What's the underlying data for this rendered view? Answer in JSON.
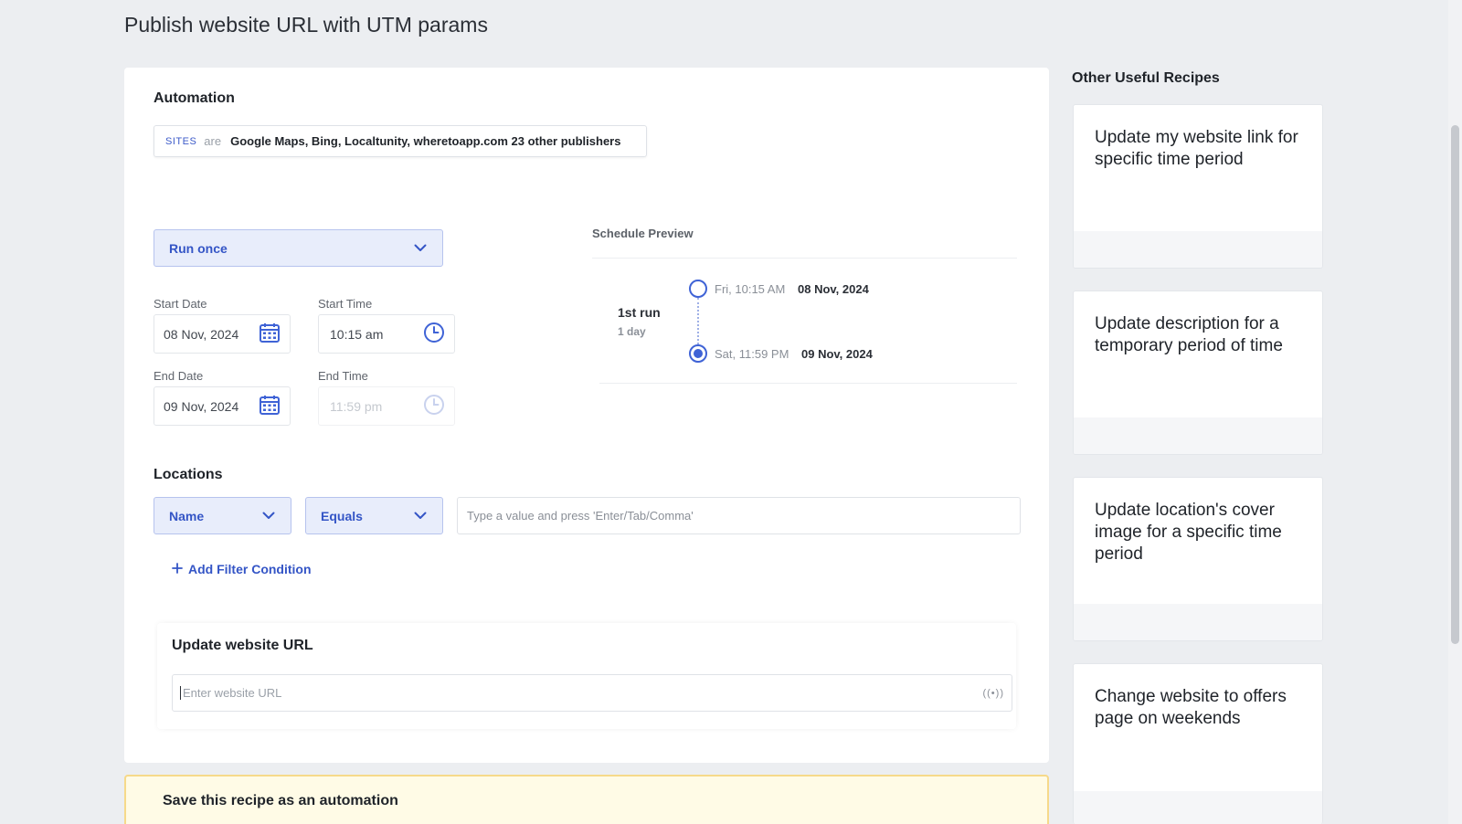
{
  "page": {
    "title": "Publish website URL with UTM params"
  },
  "automation": {
    "heading": "Automation",
    "sites": {
      "key": "SITES",
      "operator": "are",
      "value": "Google Maps, Bing, Localtunity, wheretoapp.com 23 other publishers"
    }
  },
  "schedule": {
    "frequency": "Run once",
    "start_date_label": "Start Date",
    "start_date": "08 Nov, 2024",
    "start_time_label": "Start Time",
    "start_time": "10:15 am",
    "end_date_label": "End Date",
    "end_date": "09 Nov, 2024",
    "end_time_label": "End Time",
    "end_time": "11:59 pm",
    "preview": {
      "title": "Schedule Preview",
      "run_label": "1st run",
      "run_duration": "1 day",
      "start": {
        "time": "Fri, 10:15 AM",
        "date": "08 Nov, 2024"
      },
      "end": {
        "time": "Sat, 11:59 PM",
        "date": "09 Nov, 2024"
      }
    }
  },
  "locations": {
    "heading": "Locations",
    "field": "Name",
    "operator": "Equals",
    "value_placeholder": "Type a value and press 'Enter/Tab/Comma'",
    "add_filter": "Add Filter Condition"
  },
  "action": {
    "heading": "Update website URL",
    "url_placeholder": "Enter website URL",
    "variable_icon_text": "((•))"
  },
  "save": {
    "title": "Save this recipe as an automation"
  },
  "sidebar": {
    "heading": "Other Useful Recipes",
    "recipes": [
      {
        "title": "Update my website link for specific time period"
      },
      {
        "title": "Update description for a temporary period of time"
      },
      {
        "title": "Update location's cover image for a specific time period"
      },
      {
        "title": "Change website to offers page on weekends"
      }
    ]
  },
  "colors": {
    "accent": "#3455c6",
    "select_bg": "#e8edfb",
    "banner_bg": "#fffbe6",
    "banner_border": "#f6d98a"
  },
  "icons": [
    "calendar-icon",
    "clock-icon",
    "chevron-down-icon",
    "plus-icon",
    "variable-icon"
  ]
}
